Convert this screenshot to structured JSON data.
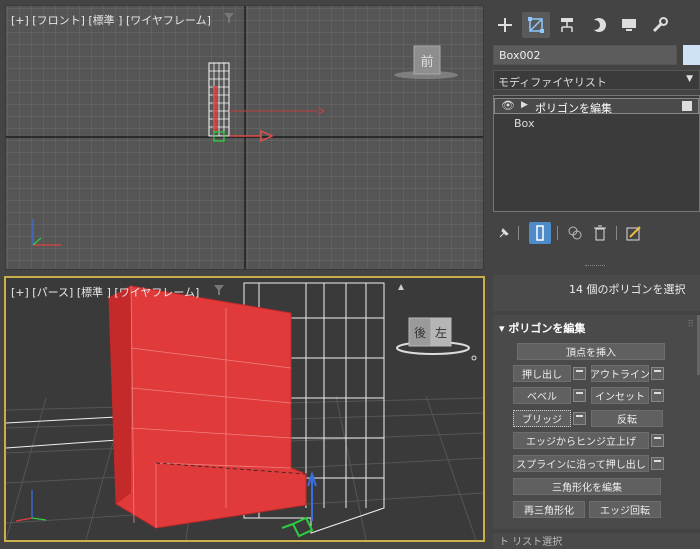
{
  "viewports": {
    "front": {
      "label": "[+] [フロント] [標準 ] [ワイヤフレーム]",
      "cube_label": "前"
    },
    "perspective": {
      "label": "[+] [パース] [標準 ] [ワイヤフレーム]",
      "cube_label_left": "後",
      "cube_label_right": "左"
    }
  },
  "command_panel": {
    "tabs": [
      {
        "icon": "plus-icon",
        "glyph": "+"
      },
      {
        "icon": "modify-icon",
        "glyph": "⌗"
      },
      {
        "icon": "hierarchy-icon",
        "glyph": "⊤"
      },
      {
        "icon": "motion-icon",
        "glyph": "◐"
      },
      {
        "icon": "display-icon",
        "glyph": "▬"
      },
      {
        "icon": "utilities-icon",
        "glyph": "🔧"
      }
    ],
    "object_name": "Box002",
    "object_color": "#cfe1f5",
    "modifier_list": "モディファイヤリスト",
    "stack": [
      {
        "label": "ポリゴンを編集"
      },
      {
        "label": "Box"
      }
    ],
    "selection_info": "14 個のポリゴンを選択",
    "rollout": {
      "title": "ポリゴンを編集",
      "buttons": {
        "insert_vertex": "頂点を挿入",
        "extrude": "押し出し",
        "outline": "アウトライン",
        "bevel": "ベベル",
        "inset": "インセット",
        "bridge": "ブリッジ",
        "flip": "反転",
        "hinge": "エッジからヒンジ立上げ",
        "extrude_spline": "スプラインに沿って押し出し",
        "edit_tri": "三角形化を編集",
        "retriangulate": "再三角形化",
        "turn": "エッジ回転"
      }
    },
    "next_rollout": "ト リスト選択"
  },
  "colors": {
    "selection_red": "#e03a3a",
    "active_border": "#c9b04a",
    "accent_blue": "#4d8bc9"
  }
}
